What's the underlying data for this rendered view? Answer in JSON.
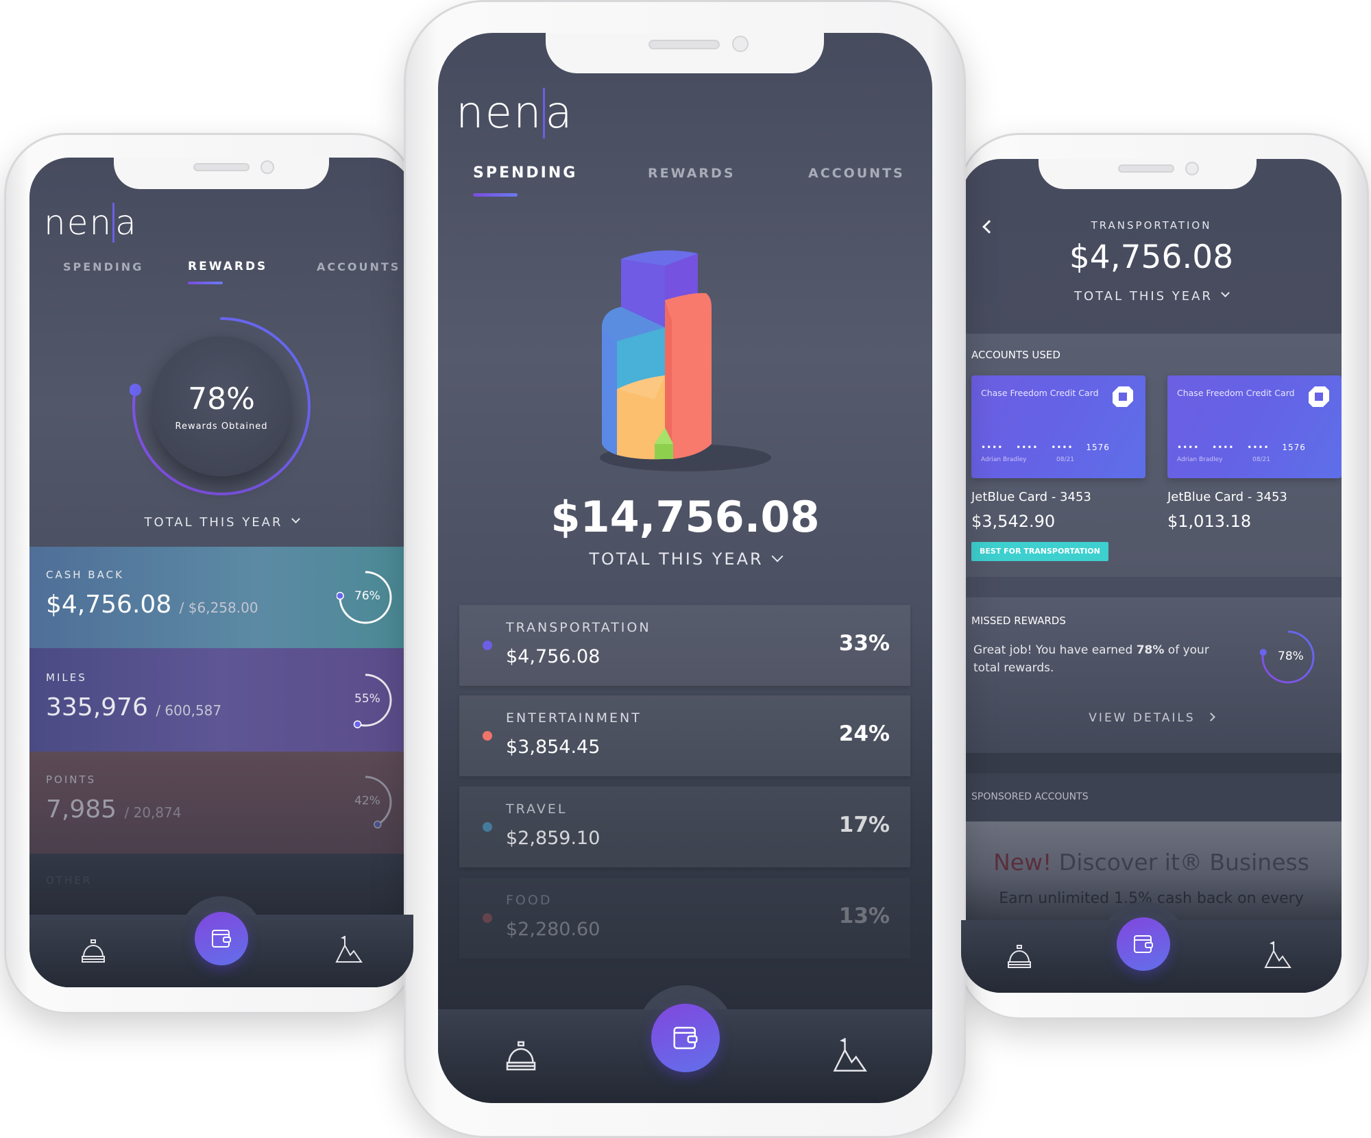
{
  "center": {
    "logo": "nena",
    "tabs": [
      "SPENDING",
      "REWARDS",
      "ACCOUNTS"
    ],
    "active_tab": "SPENDING",
    "total": "$14,756.08",
    "total_label": "TOTAL THIS YEAR",
    "categories": [
      {
        "label": "TRANSPORTATION",
        "amount": "$4,756.08",
        "percent": "33%",
        "color": "#6b5fe6"
      },
      {
        "label": "ENTERTAINMENT",
        "amount": "$3,854.45",
        "percent": "24%",
        "color": "#f0746a"
      },
      {
        "label": "TRAVEL",
        "amount": "$2,859.10",
        "percent": "17%",
        "color": "#4aa8d8"
      },
      {
        "label": "FOOD",
        "amount": "$2,280.60",
        "percent": "13%",
        "color": "#e06a62"
      }
    ],
    "nav": [
      "bell-icon",
      "wallet-icon",
      "mountain-flag-icon"
    ]
  },
  "left": {
    "logo": "nena",
    "tabs": [
      "SPENDING",
      "REWARDS",
      "ACCOUNTS"
    ],
    "active_tab": "REWARDS",
    "gauge": {
      "percent_label": "78%",
      "percent": 78,
      "label": "Rewards Obtained"
    },
    "total_label": "TOTAL THIS YEAR",
    "rewards": [
      {
        "label": "CASH BACK",
        "value": "$4,756.08",
        "target": "/ $6,258.00",
        "percent_label": "76%",
        "percent": 76
      },
      {
        "label": "MILES",
        "value": "335,976",
        "target": "/ 600,587",
        "percent_label": "55%",
        "percent": 55
      },
      {
        "label": "POINTS",
        "value": "7,985",
        "target": "/ 20,874",
        "percent_label": "42%",
        "percent": 42
      },
      {
        "label": "OTHER"
      }
    ]
  },
  "right": {
    "category": "TRANSPORTATION",
    "total": "$4,756.08",
    "total_label": "TOTAL THIS YEAR",
    "accounts_title": "ACCOUNTS USED",
    "accounts": [
      {
        "card_name": "Chase Freedom Credit Card",
        "masked": "•••• •••• ••••",
        "last4": "1576",
        "holder": "Adrian Bradley",
        "expiry": "08/21",
        "title": "JetBlue Card - 3453",
        "amount": "$3,542.90",
        "badge": "BEST FOR TRANSPORTATION"
      },
      {
        "card_name": "Chase Freedom Credit Card",
        "masked": "•••• •••• ••••",
        "last4": "1576",
        "holder": "Adrian Bradley",
        "expiry": "08/21",
        "title": "JetBlue Card - 3453",
        "amount": "$1,013.18"
      }
    ],
    "missed": {
      "title": "MISSED REWARDS",
      "text_before": "Great job! You have earned ",
      "text_bold": "78%",
      "text_after": " of your total rewards.",
      "percent_label": "78%",
      "percent": 78,
      "link": "VIEW DETAILS"
    },
    "sponsored": {
      "title": "SPONSORED ACCOUNTS",
      "ad_new": "New!",
      "ad_title": "Discover it® Business",
      "ad_sub": "Earn unlimited 1.5% cash back on every"
    }
  },
  "colors": {
    "accent": "#6b5fe6",
    "badge": "#3ecfcf",
    "background": "#474b5e"
  }
}
